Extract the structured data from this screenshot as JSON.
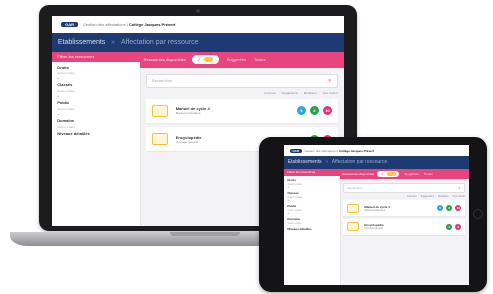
{
  "app": {
    "logo": "GAR",
    "breadcrumb_prefix": "Gestion des affectations | ",
    "school": "Collège Jacques Prévert"
  },
  "header": {
    "title": "Etablissements",
    "separator": "»",
    "current": "Affectation par ressource"
  },
  "sidebar": {
    "title": "Filtrer les ressources",
    "filters": [
      {
        "label": "Droits",
        "hint": "Aucun critère",
        "value": "+"
      },
      {
        "label": "Classes",
        "hint": "Aucun critère",
        "value": "+"
      },
      {
        "label": "Public",
        "hint": "Aucun critère",
        "value": "+"
      },
      {
        "label": "Domaine",
        "hint": "Aucun critère",
        "value": ""
      },
      {
        "label": "Niveaux détaillés",
        "hint": "",
        "value": ""
      }
    ]
  },
  "main": {
    "tab_available": "Ressources disponibles",
    "tab_active_count": "2",
    "tab_suggested": "Suggérées",
    "tab_all": "Toutes",
    "search_placeholder": "Rechercher",
    "search_icon": "search-icon",
    "sort_labels": [
      "Licences",
      "Suggestions",
      "Modifiées",
      "Tout cocher"
    ],
    "resources": [
      {
        "name": "Manuel de cycle 4",
        "subtitle": "Manuel numérique",
        "icon": "book-icon",
        "badges": [
          {
            "value": "5",
            "color": "#2aa8e0"
          },
          {
            "value": "3",
            "color": "#2e9e4f"
          },
          {
            "value": "10",
            "color": "#e0337a"
          }
        ]
      },
      {
        "name": "Encyclopédie",
        "subtitle": "Ouvrage général",
        "icon": "book-icon",
        "badges": [
          {
            "value": "1",
            "color": "#2e9e4f"
          },
          {
            "value": "3",
            "color": "#e0337a"
          }
        ]
      }
    ]
  },
  "colors": {
    "navy": "#1d3a72",
    "pink": "#e8457f",
    "yellow": "#f7c948"
  }
}
